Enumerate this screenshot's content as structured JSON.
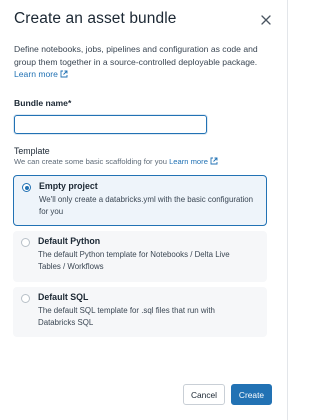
{
  "dialog": {
    "title": "Create an asset bundle",
    "close_icon": "close-icon",
    "description": "Define notebooks, jobs, pipelines and configuration as code and group them together in a source-controlled deployable package.",
    "learn_more": "Learn more"
  },
  "bundle_name": {
    "label": "Bundle name*",
    "value": "",
    "placeholder": ""
  },
  "template": {
    "label": "Template",
    "hint": "We can create some basic scaffolding for you",
    "hint_link": "Learn more",
    "selected": "Empty project",
    "options": [
      {
        "title": "Empty project",
        "description": "We'll only create a databricks.yml with the basic configuration for you"
      },
      {
        "title": "Default Python",
        "description": "The default Python template for Notebooks / Delta Live Tables / Workflows"
      },
      {
        "title": "Default SQL",
        "description": "The default SQL template for .sql files that run with Databricks SQL"
      }
    ]
  },
  "footer": {
    "cancel_label": "Cancel",
    "create_label": "Create"
  },
  "colors": {
    "accent": "#2272b4",
    "selected_bg": "#eef4fa",
    "option_bg": "#f6f7f9"
  }
}
